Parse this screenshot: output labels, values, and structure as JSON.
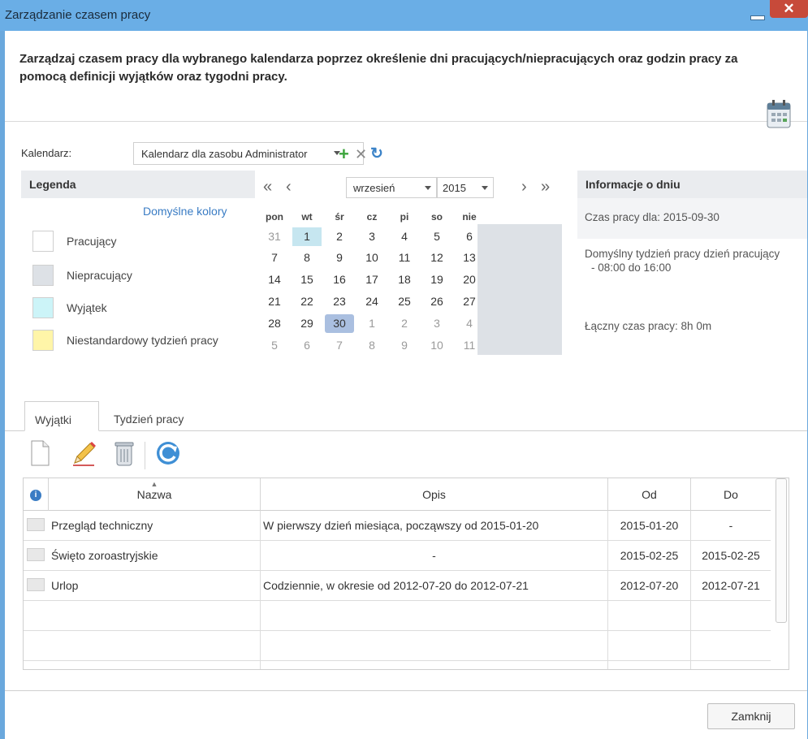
{
  "window": {
    "title": "Zarządzanie czasem pracy",
    "close_symbol": "✕"
  },
  "header": {
    "text": "Zarządzaj czasem pracy dla wybranego kalendarza poprzez określenie dni pracujących/niepracujących oraz godzin pracy za pomocą definicji wyjątków oraz tygodni pracy."
  },
  "calendar_select": {
    "label": "Kalendarz:",
    "value": "Kalendarz dla zasobu Administrator"
  },
  "legend": {
    "title": "Legenda",
    "default_colors": "Domyślne kolory",
    "items": [
      {
        "label": "Pracujący",
        "color": "#ffffff"
      },
      {
        "label": "Niepracujący",
        "color": "#dde1e6"
      },
      {
        "label": "Wyjątek",
        "color": "#ccf4f8"
      },
      {
        "label": "Niestandardowy tydzień pracy",
        "color": "#fff5a8"
      }
    ]
  },
  "calendar": {
    "prev_year": "«",
    "prev_month": "‹",
    "next_month": "›",
    "next_year": "»",
    "month": "wrzesień",
    "year": "2015",
    "weekdays": [
      "pon",
      "wt",
      "śr",
      "cz",
      "pi",
      "so",
      "nie"
    ],
    "weeks": [
      [
        "31",
        "1",
        "2",
        "3",
        "4",
        "5",
        "6"
      ],
      [
        "7",
        "8",
        "9",
        "10",
        "11",
        "12",
        "13"
      ],
      [
        "14",
        "15",
        "16",
        "17",
        "18",
        "19",
        "20"
      ],
      [
        "21",
        "22",
        "23",
        "24",
        "25",
        "26",
        "27"
      ],
      [
        "28",
        "29",
        "30",
        "1",
        "2",
        "3",
        "4"
      ],
      [
        "5",
        "6",
        "7",
        "8",
        "9",
        "10",
        "11"
      ]
    ]
  },
  "day_info": {
    "title": "Informacje o dniu",
    "date_line": "Czas pracy dla: 2015-09-30",
    "week_line": "Domyślny tydzień pracy dzień pracujący",
    "hours_line": "- 08:00 do 16:00",
    "total_line": "Łączny czas pracy: 8h 0m"
  },
  "tabs": {
    "exceptions": "Wyjątki",
    "work_week": "Tydzień pracy"
  },
  "grid": {
    "columns": {
      "info": "i",
      "name": "Nazwa",
      "desc": "Opis",
      "from": "Od",
      "to": "Do"
    },
    "rows": [
      {
        "name": "Przegląd techniczny",
        "desc": "W pierwszy dzień miesiąca, począwszy od 2015-01-20",
        "from": "2015-01-20",
        "to": "-"
      },
      {
        "name": "Święto zoroastryjskie",
        "desc": "-",
        "from": "2015-02-25",
        "to": "2015-02-25"
      },
      {
        "name": "Urlop",
        "desc": "Codziennie, w okresie od 2012-07-20 do 2012-07-21",
        "from": "2012-07-20",
        "to": "2012-07-21"
      }
    ]
  },
  "footer": {
    "close_label": "Zamknij"
  }
}
